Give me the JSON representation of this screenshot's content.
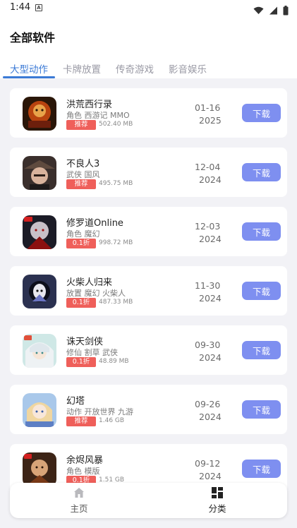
{
  "status_bar": {
    "time": "1:44",
    "notification_glyph": "A"
  },
  "page": {
    "title": "全部软件"
  },
  "tabs": [
    {
      "label": "大型动作",
      "active": true
    },
    {
      "label": "卡牌放置",
      "active": false
    },
    {
      "label": "传奇游戏",
      "active": false
    },
    {
      "label": "影音娱乐",
      "active": false
    }
  ],
  "apps": [
    {
      "name": "洪荒西行录",
      "tags": "角色 西游记 MMO",
      "badge": "推荐",
      "size": "502.40 MB",
      "date_md": "01-16",
      "date_y": "2025",
      "download": "下载"
    },
    {
      "name": "不良人3",
      "tags": "武侠 国风",
      "badge": "推荐",
      "size": "495.75 MB",
      "date_md": "12-04",
      "date_y": "2024",
      "download": "下载"
    },
    {
      "name": "修罗道Online",
      "tags": "角色 魔幻",
      "badge": "0.1折",
      "size": "998.72 MB",
      "date_md": "12-03",
      "date_y": "2024",
      "download": "下载"
    },
    {
      "name": "火柴人归来",
      "tags": "放置 魔幻 火柴人",
      "badge": "0.1折",
      "size": "487.33 MB",
      "date_md": "11-30",
      "date_y": "2024",
      "download": "下载"
    },
    {
      "name": "诛天剑侠",
      "tags": "修仙 割草 武侠",
      "badge": "0.1折",
      "size": "48.89 MB",
      "date_md": "09-30",
      "date_y": "2024",
      "download": "下载"
    },
    {
      "name": "幻塔",
      "tags": "动作 开放世界 九游",
      "badge": "推荐",
      "size": "1.46 GB",
      "date_md": "09-26",
      "date_y": "2024",
      "download": "下载"
    },
    {
      "name": "余烬风暴",
      "tags": "角色 模版",
      "badge": "0.1折",
      "size": "1.51 GB",
      "date_md": "09-12",
      "date_y": "2024",
      "download": "下载"
    }
  ],
  "bottom_nav": [
    {
      "label": "主页",
      "icon": "home-icon",
      "active": false
    },
    {
      "label": "分类",
      "icon": "category-grid-icon",
      "active": true
    }
  ],
  "colors": {
    "accent_tab": "#3b7ad6",
    "download_button": "#7e8ff0",
    "badge": "#ef5f5a",
    "background": "#f2f2f6"
  }
}
